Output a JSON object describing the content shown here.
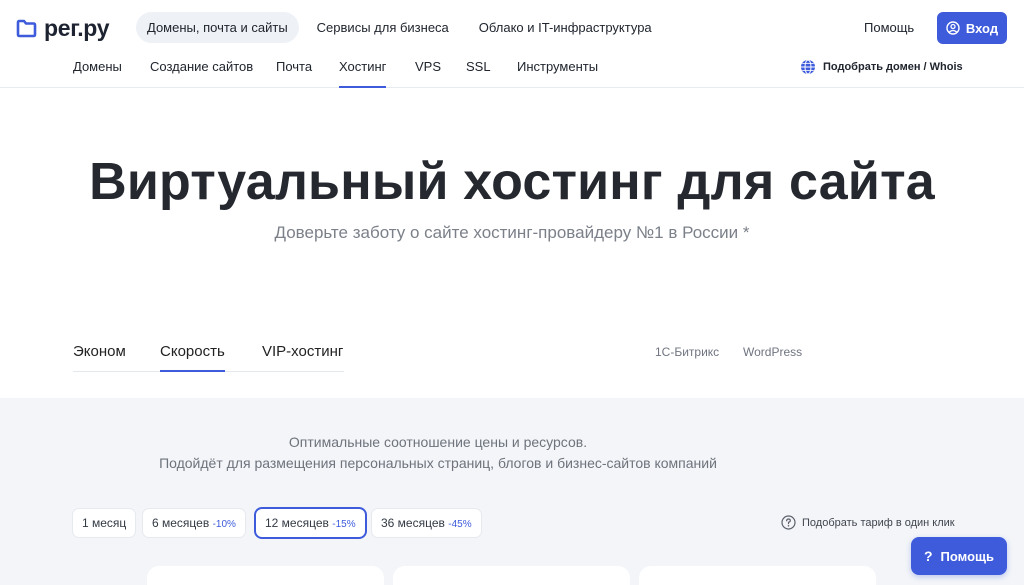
{
  "brand": {
    "name": "рег.ру",
    "color": "#3d5bdb"
  },
  "top_nav": [
    {
      "label": "Домены, почта и сайты",
      "active": true
    },
    {
      "label": "Сервисы для бизнеса",
      "active": false
    },
    {
      "label": "Облако и IT-инфраструктура",
      "active": false
    }
  ],
  "header": {
    "help": "Помощь",
    "login": "Вход",
    "login_icon": "user-circle-icon"
  },
  "sub_nav": [
    {
      "label": "Домены"
    },
    {
      "label": "Создание сайтов"
    },
    {
      "label": "Почта"
    },
    {
      "label": "Хостинг",
      "active": true
    },
    {
      "label": "VPS"
    },
    {
      "label": "SSL"
    },
    {
      "label": "Инструменты"
    }
  ],
  "whois": {
    "label": "Подобрать домен / Whois",
    "icon": "globe-icon"
  },
  "hero": {
    "title": "Виртуальный хостинг для сайта",
    "subtitle": "Доверьте заботу о сайте хостинг-провайдеру №1 в России *"
  },
  "plan_tabs": [
    {
      "label": "Эконом"
    },
    {
      "label": "Скорость",
      "active": true
    },
    {
      "label": "VIP-хостинг"
    }
  ],
  "cms_links": [
    "1С-Битрикс",
    "WordPress"
  ],
  "description": {
    "line1": "Оптимальные соотношение цены и ресурсов.",
    "line2": "Подойдёт для размещения персональных страниц, блогов и бизнес-сайтов компаний"
  },
  "periods": [
    {
      "label": "1 месяц",
      "discount": ""
    },
    {
      "label": "6 месяцев",
      "discount": "-10%"
    },
    {
      "label": "12 месяцев",
      "discount": "-15%",
      "active": true
    },
    {
      "label": "36 месяцев",
      "discount": "-45%"
    }
  ],
  "picker": {
    "label": "Подобрать тариф в один клик",
    "icon": "question-circle-icon"
  },
  "help_button": {
    "icon_glyph": "?",
    "label": "Помощь"
  }
}
